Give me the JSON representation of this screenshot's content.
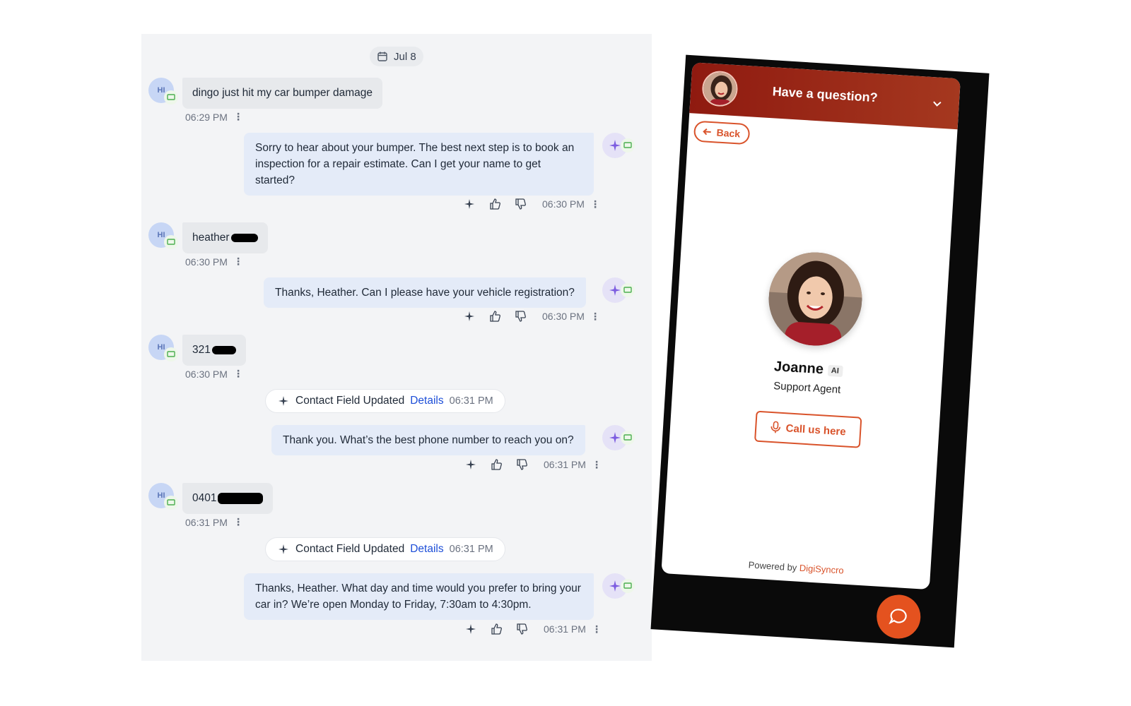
{
  "chat": {
    "date": "Jul 8",
    "avatar_initials": "HI",
    "messages": [
      {
        "text": "dingo just hit my car bumper damage",
        "time": "06:29 PM"
      },
      {
        "text": "Sorry to hear about your bumper. The best next step is to book an inspection for a repair estimate. Can I get your name to get started?",
        "time": "06:30 PM"
      },
      {
        "text": "heather",
        "time": "06:30 PM"
      },
      {
        "text": "Thanks, Heather. Can I please have your vehicle registration?",
        "time": "06:30 PM"
      },
      {
        "text": "321",
        "time": "06:30 PM"
      },
      {
        "text": "Thank you. What’s the best phone number to reach you on?",
        "time": "06:31 PM"
      },
      {
        "text": "0401",
        "time": "06:31 PM"
      },
      {
        "text": "Thanks, Heather. What day and time would you prefer to bring your car in? We’re open Monday to Friday, 7:30am to 4:30pm.",
        "time": "06:31 PM"
      }
    ],
    "system_events": [
      {
        "label": "Contact Field Updated",
        "link": "Details",
        "time": "06:31 PM"
      },
      {
        "label": "Contact Field Updated",
        "link": "Details",
        "time": "06:31 PM"
      }
    ]
  },
  "widget": {
    "header_title": "Have a question?",
    "back_label": "Back",
    "agent_name": "Joanne",
    "agent_badge": "AI",
    "agent_role": "Support Agent",
    "call_label": "Call us here",
    "powered_by": "Powered by",
    "brand": "DigiSyncro",
    "accent_color": "#d9532b",
    "header_color": "#8f1a10"
  }
}
